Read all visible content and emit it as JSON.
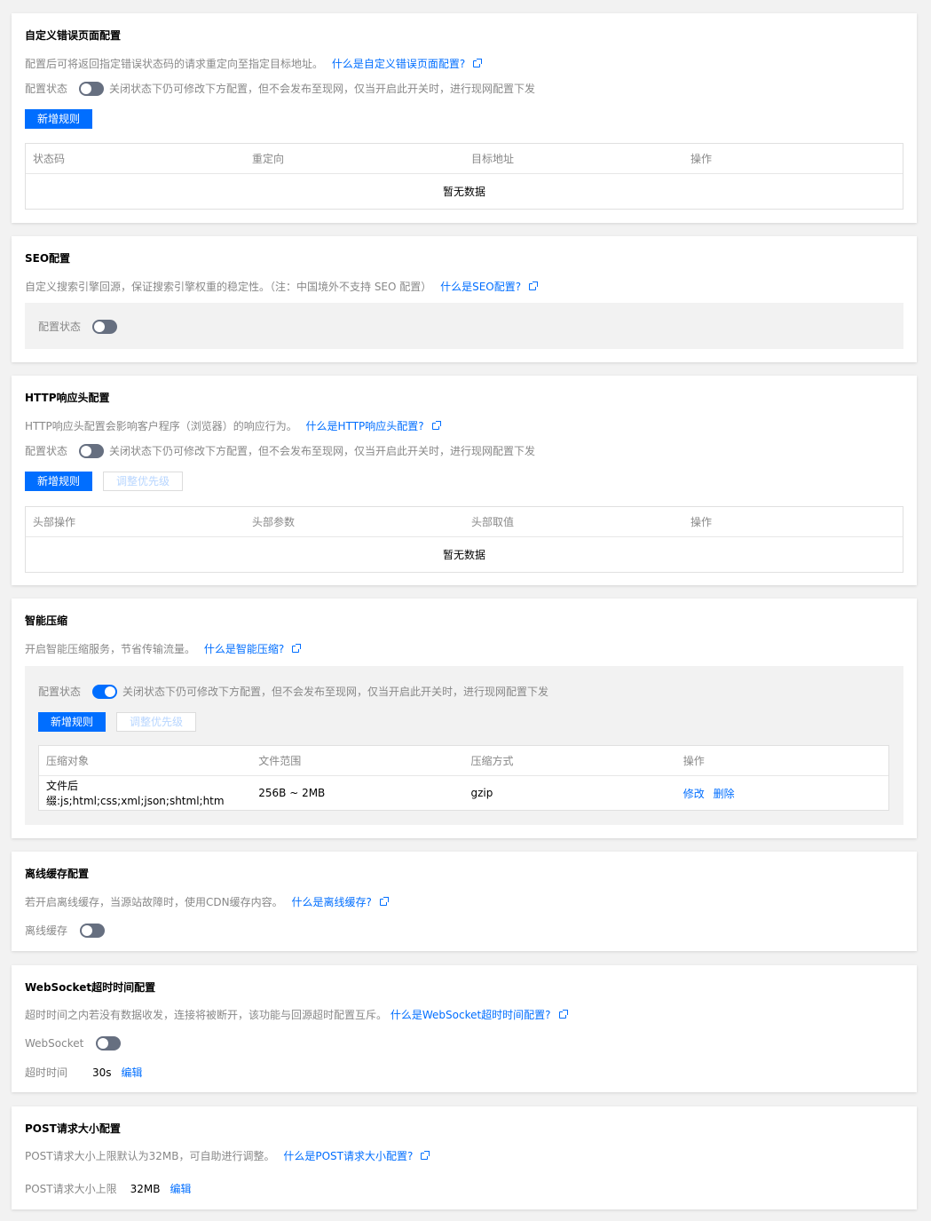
{
  "error_page": {
    "title": "自定义错误页面配置",
    "desc": "配置后可将返回指定错误状态码的请求重定向至指定目标地址。",
    "link": "什么是自定义错误页面配置?",
    "status_label": "配置状态",
    "status_note": "关闭状态下仍可修改下方配置，但不会发布至现网，仅当开启此开关时，进行现网配置下发",
    "add_button": "新增规则",
    "columns": [
      "状态码",
      "重定向",
      "目标地址",
      "操作"
    ],
    "empty": "暂无数据"
  },
  "seo": {
    "title": "SEO配置",
    "desc": "自定义搜索引擎回源，保证搜索引擎权重的稳定性。（注：中国境外不支持 SEO 配置）",
    "link": "什么是SEO配置?",
    "status_label": "配置状态"
  },
  "http_header": {
    "title": "HTTP响应头配置",
    "desc": "HTTP响应头配置会影响客户程序（浏览器）的响应行为。",
    "link": "什么是HTTP响应头配置?",
    "status_label": "配置状态",
    "status_note": "关闭状态下仍可修改下方配置，但不会发布至现网，仅当开启此开关时，进行现网配置下发",
    "add_button": "新增规则",
    "priority_button": "调整优先级",
    "columns": [
      "头部操作",
      "头部参数",
      "头部取值",
      "操作"
    ],
    "empty": "暂无数据"
  },
  "compression": {
    "title": "智能压缩",
    "desc": "开启智能压缩服务，节省传输流量。",
    "link": "什么是智能压缩?",
    "status_label": "配置状态",
    "status_note": "关闭状态下仍可修改下方配置，但不会发布至现网，仅当开启此开关时，进行现网配置下发",
    "add_button": "新增规则",
    "priority_button": "调整优先级",
    "columns": [
      "压缩对象",
      "文件范围",
      "压缩方式",
      "操作"
    ],
    "row": {
      "target": "文件后缀:js;html;css;xml;json;shtml;htm",
      "range": "256B ~ 2MB",
      "method": "gzip",
      "edit": "修改",
      "delete": "删除"
    }
  },
  "offline_cache": {
    "title": "离线缓存配置",
    "desc": "若开启离线缓存，当源站故障时，使用CDN缓存内容。",
    "link": "什么是离线缓存?",
    "label": "离线缓存"
  },
  "websocket": {
    "title": "WebSocket超时时间配置",
    "desc": "超时时间之内若没有数据收发，连接将被断开，该功能与回源超时配置互斥。",
    "link": "什么是WebSocket超时时间配置?",
    "label": "WebSocket",
    "timeout_label": "超时时间",
    "timeout_value": "30s",
    "edit": "编辑"
  },
  "post_size": {
    "title": "POST请求大小配置",
    "desc": "POST请求大小上限默认为32MB，可自助进行调整。",
    "link": "什么是POST请求大小配置?",
    "limit_label": "POST请求大小上限",
    "limit_value": "32MB",
    "edit": "编辑"
  },
  "toggles": {
    "error_page": false,
    "seo": false,
    "http_header": false,
    "compression": true,
    "offline_cache": false,
    "websocket": false
  },
  "colors": {
    "primary": "#006eff",
    "toggle_off": "#666f80",
    "muted_text": "#888888"
  }
}
